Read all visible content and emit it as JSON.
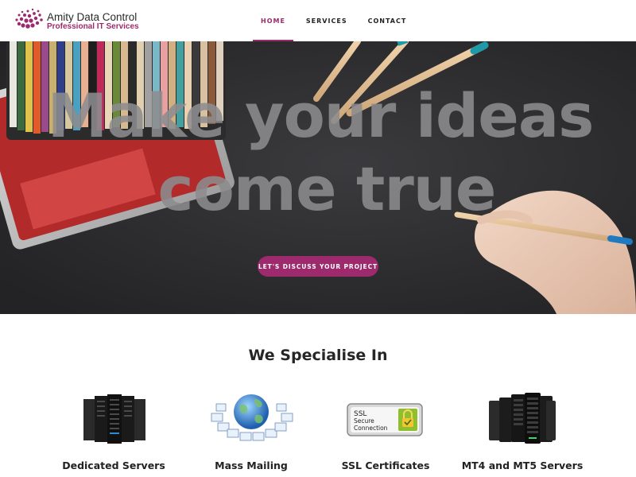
{
  "brand": {
    "name": "Amity Data Control",
    "tagline": "Professional IT Services",
    "accent": "#9c2a6d"
  },
  "nav": {
    "items": [
      {
        "label": "HOME",
        "active": true
      },
      {
        "label": "SERVICES",
        "active": false
      },
      {
        "label": "CONTACT",
        "active": false
      }
    ]
  },
  "hero": {
    "title_line1": "Make your ideas",
    "title_line2": "come true",
    "cta_label": "LET'S DISCUSS YOUR PROJECT"
  },
  "specialise": {
    "heading": "We Specialise In",
    "items": [
      {
        "label": "Dedicated Servers",
        "icon": "server-rack-icon"
      },
      {
        "label": "Mass Mailing",
        "icon": "globe-mail-icon"
      },
      {
        "label": "SSL Certificates",
        "icon": "ssl-badge-icon"
      },
      {
        "label": "MT4 and MT5 Servers",
        "icon": "server-cluster-icon"
      }
    ],
    "ssl_badge": {
      "line1": "SSL",
      "line2": "Secure",
      "line3": "Connection"
    }
  }
}
